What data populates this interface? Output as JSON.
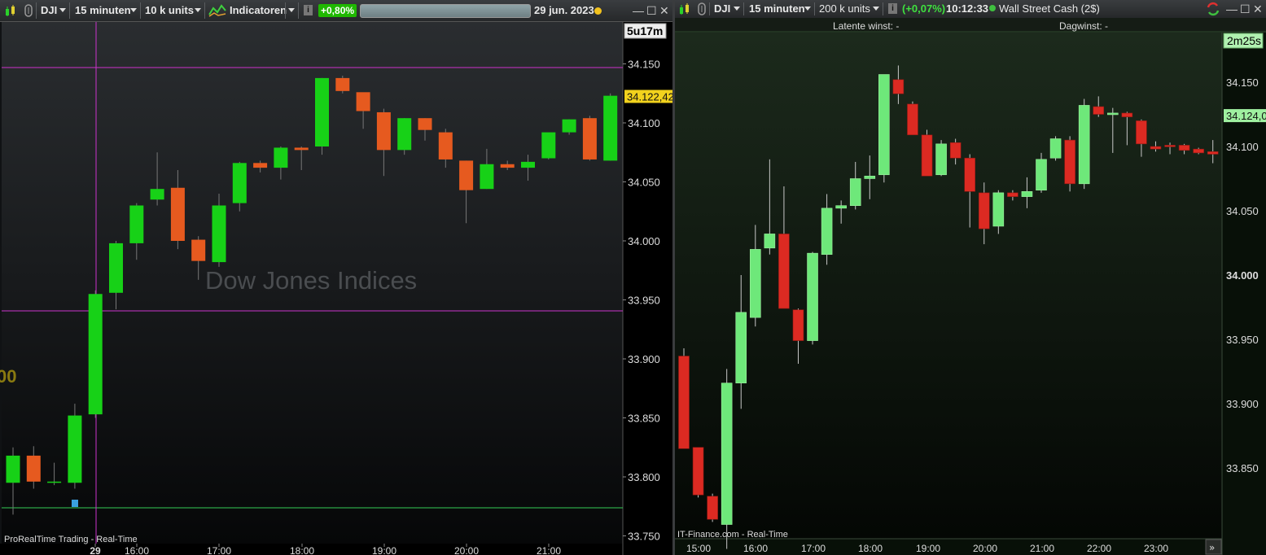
{
  "left": {
    "toolbar": {
      "symbol": "DJI",
      "timeframe": "15 minuten",
      "units": "10 k units",
      "indicators": "Indicatoren",
      "change_pct": "+0,80%",
      "date": "29 jun. 2023",
      "info_icon": "info-icon"
    },
    "countdown": "5u17m",
    "watermark": "Dow Jones Indices",
    "footer": "ProRealTime Trading - Real-Time",
    "left_edge_label": "00",
    "current_price_label": "34.122,42",
    "axis": {
      "y_ticks": [
        "34.150",
        "34.100",
        "34.050",
        "34.000",
        "33.950",
        "33.900",
        "33.850",
        "33.800",
        "33.750"
      ],
      "x_ticks": [
        "29",
        "16:00",
        "17:00",
        "18:00",
        "19:00",
        "20:00",
        "21:00"
      ]
    },
    "colors": {
      "up": "#17d117",
      "down": "#e65a1f",
      "price_badge": "#f2d21d",
      "hline": "#cc33cc",
      "green_hline": "#33cc55"
    }
  },
  "right": {
    "toolbar": {
      "symbol": "DJI",
      "timeframe": "15 minuten",
      "units": "200 k units",
      "change_pct": "(+0,07%)",
      "time": "10:12:33",
      "instrument": "Wall Street Cash (2$)",
      "info_icon": "info-icon"
    },
    "latent_label": "Latente winst: -",
    "day_label": "Dagwinst: -",
    "countdown": "2m25s",
    "footer": "IT-Finance.com - Real-Time",
    "current_price_label": "34.124,0",
    "axis": {
      "y_ticks": [
        "34.150",
        "34.100",
        "34.050",
        "34.000",
        "33.950",
        "33.900",
        "33.850"
      ],
      "x_ticks": [
        "15:00",
        "16:00",
        "17:00",
        "18:00",
        "19:00",
        "20:00",
        "21:00",
        "22:00",
        "23:00"
      ]
    },
    "colors": {
      "up": "#6ee87a",
      "down": "#dc2a22",
      "price_badge": "#9ff0a0"
    }
  },
  "chart_data": [
    {
      "type": "candlestick",
      "title": "",
      "interval": "15 minuten",
      "ylim": [
        33760,
        34170
      ],
      "x_ticks": [
        "29",
        "16:00",
        "17:00",
        "18:00",
        "19:00",
        "20:00",
        "21:00"
      ],
      "y_ticks": [
        34150,
        34100,
        34050,
        34000,
        33950,
        33900,
        33850,
        33800,
        33750
      ],
      "series": [
        {
          "candles": [
            {
              "o": 33795,
              "h": 33825,
              "l": 33768,
              "c": 33818
            },
            {
              "o": 33818,
              "h": 33826,
              "l": 33790,
              "c": 33796
            },
            {
              "o": 33796,
              "h": 33812,
              "l": 33793,
              "c": 33796
            },
            {
              "o": 33795,
              "h": 33862,
              "l": 33790,
              "c": 33852
            },
            {
              "o": 33853,
              "h": 33958,
              "l": 33850,
              "c": 33955
            },
            {
              "o": 33956,
              "h": 34000,
              "l": 33942,
              "c": 33998
            },
            {
              "o": 33998,
              "h": 34032,
              "l": 33984,
              "c": 34030
            },
            {
              "o": 34035,
              "h": 34075,
              "l": 34030,
              "c": 34044
            },
            {
              "o": 34045,
              "h": 34060,
              "l": 33993,
              "c": 34000
            },
            {
              "o": 34001,
              "h": 34004,
              "l": 33967,
              "c": 33983
            },
            {
              "o": 33982,
              "h": 34040,
              "l": 33978,
              "c": 34030
            },
            {
              "o": 34032,
              "h": 34067,
              "l": 34025,
              "c": 34066
            },
            {
              "o": 34066,
              "h": 34068,
              "l": 34058,
              "c": 34062
            },
            {
              "o": 34062,
              "h": 34080,
              "l": 34052,
              "c": 34079
            },
            {
              "o": 34079,
              "h": 34080,
              "l": 34060,
              "c": 34077
            },
            {
              "o": 34080,
              "h": 34138,
              "l": 34073,
              "c": 34138
            },
            {
              "o": 34138,
              "h": 34140,
              "l": 34125,
              "c": 34127
            },
            {
              "o": 34126,
              "h": 34125,
              "l": 34095,
              "c": 34110
            },
            {
              "o": 34109,
              "h": 34112,
              "l": 34055,
              "c": 34077
            },
            {
              "o": 34077,
              "h": 34104,
              "l": 34073,
              "c": 34104
            },
            {
              "o": 34104,
              "h": 34104,
              "l": 34085,
              "c": 34094
            },
            {
              "o": 34092,
              "h": 34095,
              "l": 34062,
              "c": 34069
            },
            {
              "o": 34068,
              "h": 34068,
              "l": 34015,
              "c": 34043
            },
            {
              "o": 34044,
              "h": 34078,
              "l": 34044,
              "c": 34065
            },
            {
              "o": 34065,
              "h": 34068,
              "l": 34060,
              "c": 34062
            },
            {
              "o": 34062,
              "h": 34073,
              "l": 34051,
              "c": 34067
            },
            {
              "o": 34070,
              "h": 34091,
              "l": 34069,
              "c": 34092
            },
            {
              "o": 34092,
              "h": 34103,
              "l": 34090,
              "c": 34103
            },
            {
              "o": 34104,
              "h": 34106,
              "l": 34068,
              "c": 34069
            },
            {
              "o": 34068,
              "h": 34125,
              "l": 34068,
              "c": 34123
            }
          ]
        }
      ],
      "price_label": "34.122,42"
    },
    {
      "type": "candlestick",
      "title": "",
      "instrument": "Wall Street Cash (2$)",
      "interval": "15 minuten",
      "ylim": [
        33810,
        34177
      ],
      "x_ticks": [
        "15:00",
        "16:00",
        "17:00",
        "18:00",
        "19:00",
        "20:00",
        "21:00",
        "22:00",
        "23:00"
      ],
      "y_ticks": [
        34150,
        34100,
        34050,
        34000,
        33950,
        33900,
        33850
      ],
      "series": [
        {
          "candles": [
            {
              "o": 33937,
              "h": 33943,
              "l": 33867,
              "c": 33865
            },
            {
              "o": 33866,
              "h": 33866,
              "l": 33827,
              "c": 33829
            },
            {
              "o": 33828,
              "h": 33830,
              "l": 33808,
              "c": 33810
            },
            {
              "o": 33806,
              "h": 33927,
              "l": 33787,
              "c": 33916
            },
            {
              "o": 33916,
              "h": 34000,
              "l": 33896,
              "c": 33971
            },
            {
              "o": 33967,
              "h": 34039,
              "l": 33960,
              "c": 34020
            },
            {
              "o": 34021,
              "h": 34090,
              "l": 34016,
              "c": 34032
            },
            {
              "o": 34032,
              "h": 34069,
              "l": 33986,
              "c": 33974
            },
            {
              "o": 33973,
              "h": 33974,
              "l": 33931,
              "c": 33949
            },
            {
              "o": 33949,
              "h": 34018,
              "l": 33946,
              "c": 34017
            },
            {
              "o": 34016,
              "h": 34063,
              "l": 34008,
              "c": 34052
            },
            {
              "o": 34052,
              "h": 34058,
              "l": 34040,
              "c": 34054
            },
            {
              "o": 34054,
              "h": 34088,
              "l": 34051,
              "c": 34075
            },
            {
              "o": 34075,
              "h": 34093,
              "l": 34059,
              "c": 34077
            },
            {
              "o": 34078,
              "h": 34148,
              "l": 34072,
              "c": 34156
            },
            {
              "o": 34152,
              "h": 34163,
              "l": 34133,
              "c": 34141
            },
            {
              "o": 34133,
              "h": 34135,
              "l": 34125,
              "c": 34109
            },
            {
              "o": 34109,
              "h": 34113,
              "l": 34080,
              "c": 34077
            },
            {
              "o": 34078,
              "h": 34105,
              "l": 34077,
              "c": 34102
            },
            {
              "o": 34103,
              "h": 34106,
              "l": 34086,
              "c": 34091
            },
            {
              "o": 34091,
              "h": 34094,
              "l": 34037,
              "c": 34065
            },
            {
              "o": 34064,
              "h": 34072,
              "l": 34024,
              "c": 34036
            },
            {
              "o": 34038,
              "h": 34066,
              "l": 34032,
              "c": 34064
            },
            {
              "o": 34064,
              "h": 34066,
              "l": 34058,
              "c": 34061
            },
            {
              "o": 34061,
              "h": 34076,
              "l": 34052,
              "c": 34065
            },
            {
              "o": 34066,
              "h": 34095,
              "l": 34064,
              "c": 34090
            },
            {
              "o": 34091,
              "h": 34108,
              "l": 34089,
              "c": 34106
            },
            {
              "o": 34105,
              "h": 34108,
              "l": 34065,
              "c": 34071
            },
            {
              "o": 34071,
              "h": 34137,
              "l": 34067,
              "c": 34132
            },
            {
              "o": 34131,
              "h": 34139,
              "l": 34123,
              "c": 34125
            },
            {
              "o": 34125,
              "h": 34130,
              "l": 34095,
              "c": 34126
            },
            {
              "o": 34126,
              "h": 34127,
              "l": 34101,
              "c": 34123
            },
            {
              "o": 34120,
              "h": 34121,
              "l": 34092,
              "c": 34102
            },
            {
              "o": 34100,
              "h": 34104,
              "l": 34096,
              "c": 34098
            },
            {
              "o": 34101,
              "h": 34103,
              "l": 34094,
              "c": 34100
            },
            {
              "o": 34101,
              "h": 34102,
              "l": 34094,
              "c": 34097
            },
            {
              "o": 34098,
              "h": 34099,
              "l": 34094,
              "c": 34095
            },
            {
              "o": 34096,
              "h": 34105,
              "l": 34087,
              "c": 34094
            }
          ]
        }
      ],
      "price_label": "34.124,0"
    }
  ]
}
